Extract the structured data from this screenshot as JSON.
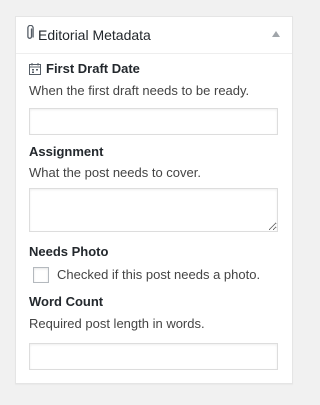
{
  "panel": {
    "title": "Editorial Metadata",
    "icon": "paperclip-icon",
    "toggle_icon": "triangle-up-icon"
  },
  "fields": {
    "first_draft_date": {
      "icon": "calendar-icon",
      "label": "First Draft Date",
      "description": "When the first draft needs to be ready.",
      "value": ""
    },
    "assignment": {
      "label": "Assignment",
      "description": "What the post needs to cover.",
      "value": ""
    },
    "needs_photo": {
      "label": "Needs Photo",
      "checkbox_label": "Checked if this post needs a photo.",
      "checked": false
    },
    "word_count": {
      "label": "Word Count",
      "description": "Required post length in words.",
      "value": ""
    }
  }
}
